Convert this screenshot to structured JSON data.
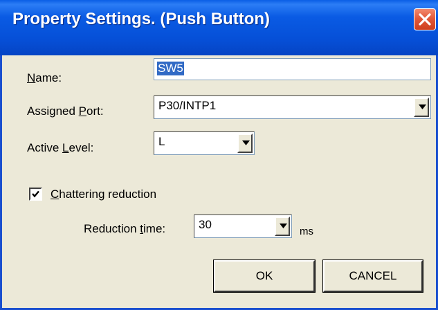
{
  "window": {
    "title": "Property Settings. (Push Button)"
  },
  "fields": {
    "name": {
      "label_mnemonic": "N",
      "label_rest": "ame:",
      "value": "SW5"
    },
    "assigned_port": {
      "label_pre": "Assigned ",
      "label_mnemonic": "P",
      "label_rest": "ort:",
      "value": "P30/INTP1"
    },
    "active_level": {
      "label_pre": "Active ",
      "label_mnemonic": "L",
      "label_rest": "evel:",
      "value": "L"
    },
    "chattering": {
      "label_mnemonic": "C",
      "label_rest": "hattering reduction",
      "checked": true
    },
    "reduction_time": {
      "label_pre": "Reduction ",
      "label_mnemonic": "t",
      "label_rest": "ime:",
      "value": "30",
      "unit": "ms"
    }
  },
  "buttons": {
    "ok": "OK",
    "cancel": "CANCEL"
  },
  "icons": {
    "close": "close-icon",
    "dropdown": "chevron-down-icon",
    "check": "checkmark-icon"
  },
  "colors": {
    "titlebar": "#0650d8",
    "close_button": "#e2593a",
    "selection": "#316ac5",
    "dialog_bg": "#ece9d8"
  }
}
